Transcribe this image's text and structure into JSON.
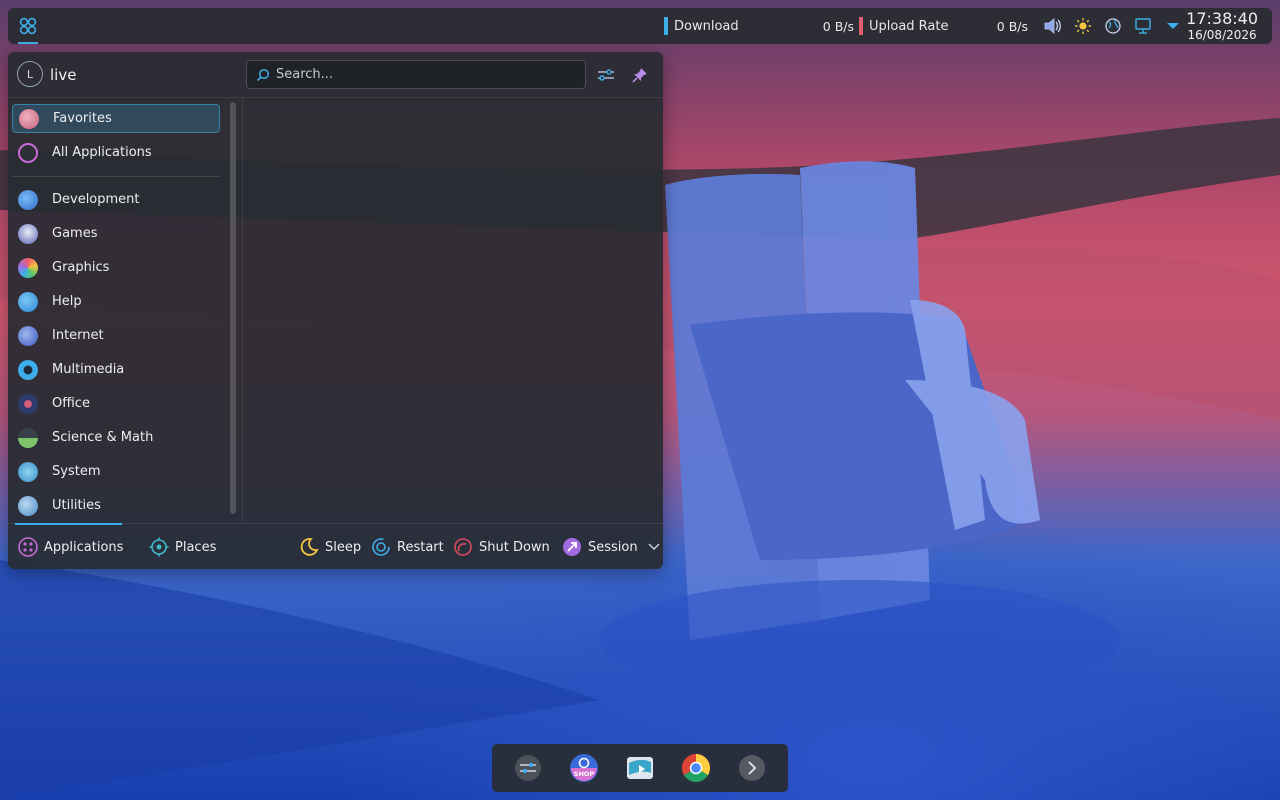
{
  "top_panel": {
    "launcher_icon": "kde-launcher-icon",
    "download_label": "Download",
    "download_rate": "0 B/s",
    "upload_label": "Upload Rate",
    "upload_rate": "0 B/s",
    "colors": {
      "download": "#3daee9",
      "upload": "#e05d6f"
    },
    "tray_icons": [
      "volume-icon",
      "brightness-icon",
      "globe-icon",
      "network-icon",
      "expand-tray-icon"
    ],
    "clock": {
      "time": "17:38:40",
      "date": "16/08/2026"
    }
  },
  "launcher": {
    "user": {
      "initial": "L",
      "name": "live"
    },
    "search": {
      "placeholder": "Search..."
    },
    "header_buttons": [
      "configure-icon",
      "pin-icon"
    ],
    "categories": [
      {
        "label": "Favorites",
        "icon": "favorites-icon",
        "active": true
      },
      {
        "label": "All Applications",
        "icon": "all-apps-icon"
      },
      {
        "label": "Development",
        "icon": "development-icon"
      },
      {
        "label": "Games",
        "icon": "games-icon"
      },
      {
        "label": "Graphics",
        "icon": "graphics-icon"
      },
      {
        "label": "Help",
        "icon": "help-icon"
      },
      {
        "label": "Internet",
        "icon": "internet-icon"
      },
      {
        "label": "Multimedia",
        "icon": "multimedia-icon"
      },
      {
        "label": "Office",
        "icon": "office-icon"
      },
      {
        "label": "Science & Math",
        "icon": "science-icon"
      },
      {
        "label": "System",
        "icon": "system-icon"
      },
      {
        "label": "Utilities",
        "icon": "utilities-icon"
      }
    ],
    "footer": {
      "applications": "Applications",
      "places": "Places",
      "sleep": "Sleep",
      "restart": "Restart",
      "shutdown": "Shut Down",
      "session": "Session"
    }
  },
  "dock": {
    "items": [
      "system-settings-icon",
      "discover-shop-icon",
      "installer-icon",
      "chrome-icon",
      "more-arrow-icon"
    ]
  }
}
